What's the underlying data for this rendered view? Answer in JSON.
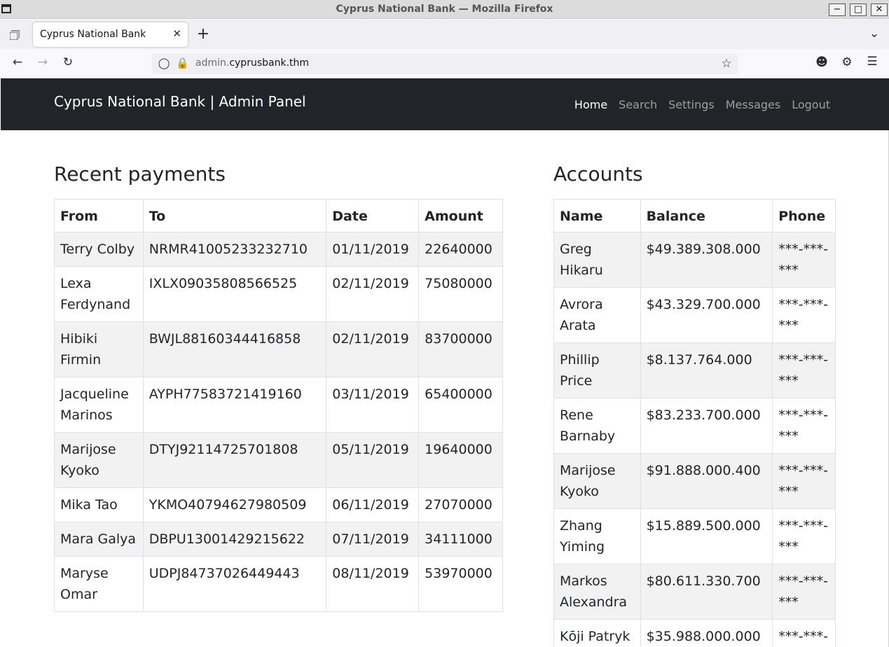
{
  "window": {
    "title": "Cyprus National Bank — Mozilla Firefox"
  },
  "browser": {
    "tab_title": "Cyprus National Bank",
    "url_prefix": "admin.",
    "url_domain": "cyprusbank.thm"
  },
  "site": {
    "brand": "Cyprus National Bank | Admin Panel",
    "nav": [
      "Home",
      "Search",
      "Settings",
      "Messages",
      "Logout"
    ],
    "nav_active": "Home"
  },
  "payments": {
    "heading": "Recent payments",
    "columns": [
      "From",
      "To",
      "Date",
      "Amount"
    ],
    "rows": [
      [
        "Terry Colby",
        "NRMR41005233232710",
        "01/11/2019",
        "22640000"
      ],
      [
        "Lexa Ferdynand",
        "IXLX09035808566525",
        "02/11/2019",
        "75080000"
      ],
      [
        "Hibiki Firmin",
        "BWJL88160344416858",
        "02/11/2019",
        "83700000"
      ],
      [
        "Jacqueline Marinos",
        "AYPH77583721419160",
        "03/11/2019",
        "65400000"
      ],
      [
        "Marijose Kyoko",
        "DTYJ92114725701808",
        "05/11/2019",
        "19640000"
      ],
      [
        "Mika Tao",
        "YKMO40794627980509",
        "06/11/2019",
        "27070000"
      ],
      [
        "Mara Galya",
        "DBPU13001429215622",
        "07/11/2019",
        "34111000"
      ],
      [
        "Maryse Omar",
        "UDPJ84737026449443",
        "08/11/2019",
        "53970000"
      ]
    ]
  },
  "accounts": {
    "heading": "Accounts",
    "columns": [
      "Name",
      "Balance",
      "Phone"
    ],
    "rows": [
      [
        "Greg Hikaru",
        "$49.389.308.000",
        "***-***-***"
      ],
      [
        "Avrora Arata",
        "$43.329.700.000",
        "***-***-***"
      ],
      [
        "Phillip Price",
        "$8.137.764.000",
        "***-***-***"
      ],
      [
        "Rene Barnaby",
        "$83.233.700.000",
        "***-***-***"
      ],
      [
        "Marijose Kyoko",
        "$91.888.000.400",
        "***-***-***"
      ],
      [
        "Zhang Yiming",
        "$15.889.500.000",
        "***-***-***"
      ],
      [
        "Markos Alexandra",
        "$80.611.330.700",
        "***-***-***"
      ],
      [
        "Kōji Patryk",
        "$35.988.000.000",
        "***-***-***"
      ]
    ]
  }
}
